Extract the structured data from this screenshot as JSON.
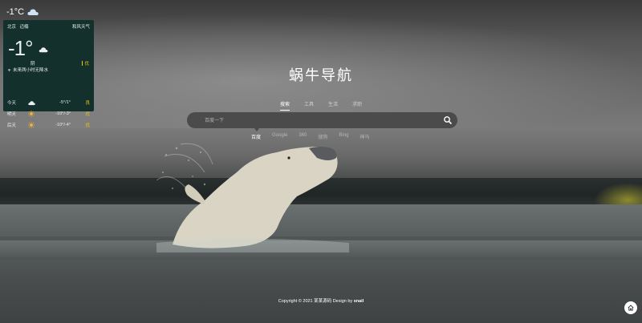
{
  "top_bar": {
    "temperature": "-1°C",
    "weather_icon": "cloud-icon"
  },
  "weather_card": {
    "city": "北京",
    "district": "迈楠",
    "provider": "和风天气",
    "temperature": "-1°",
    "condition": "阴",
    "air_quality": "优",
    "rain_forecast": "未来两小时无降水",
    "forecast": [
      {
        "day": "今天",
        "icon": "cloud-icon",
        "temp": "-5°/1°",
        "quality": "良"
      },
      {
        "day": "明天",
        "icon": "sun-icon",
        "temp": "-10°/-3°",
        "quality": "优"
      },
      {
        "day": "后天",
        "icon": "sun-icon",
        "temp": "-10°/-4°",
        "quality": "优"
      }
    ]
  },
  "logo": "蜗牛导航",
  "search": {
    "tabs": [
      {
        "label": "搜索",
        "active": true
      },
      {
        "label": "工具",
        "active": false
      },
      {
        "label": "生活",
        "active": false
      },
      {
        "label": "求职",
        "active": false
      }
    ],
    "placeholder": "百度一下",
    "engines": [
      {
        "label": "百度",
        "active": true
      },
      {
        "label": "Google",
        "active": false
      },
      {
        "label": "360",
        "active": false
      },
      {
        "label": "搜狗",
        "active": false
      },
      {
        "label": "Bing",
        "active": false
      },
      {
        "label": "神马",
        "active": false
      }
    ]
  },
  "footer": {
    "prefix": "Copyright © 2021",
    "name": "某某源码",
    "middle": "Design by",
    "author": "snail"
  },
  "colors": {
    "card_bg": "#14302c",
    "accent_yellow": "#f1c40f"
  }
}
